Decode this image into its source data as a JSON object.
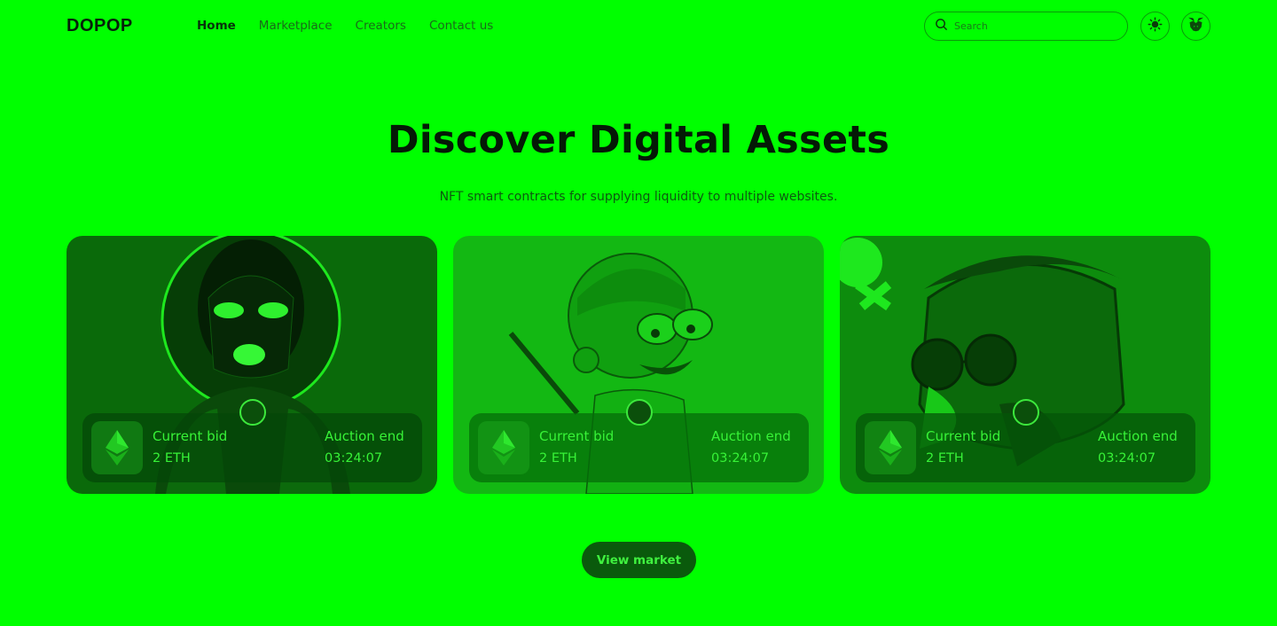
{
  "header": {
    "logo": "DOPOP",
    "nav": [
      {
        "label": "Home",
        "active": true
      },
      {
        "label": "Marketplace",
        "active": false
      },
      {
        "label": "Creators",
        "active": false
      },
      {
        "label": "Contact us",
        "active": false
      }
    ],
    "search_placeholder": "Search",
    "icons": {
      "search": "search-icon",
      "theme": "sun-icon",
      "wallet": "metamask-fox-icon"
    }
  },
  "hero": {
    "title": "Discover Digital Assets",
    "subtitle": "NFT smart contracts for supplying liquidity to multiple websites."
  },
  "cards": [
    {
      "bid_label": "Current bid",
      "bid_value": "2 ETH",
      "end_label": "Auction end",
      "end_value": "03:24:07",
      "currency_icon": "ethereum-icon"
    },
    {
      "bid_label": "Current bid",
      "bid_value": "2 ETH",
      "end_label": "Auction end",
      "end_value": "03:24:07",
      "currency_icon": "ethereum-icon"
    },
    {
      "bid_label": "Current bid",
      "bid_value": "2 ETH",
      "end_label": "Auction end",
      "end_value": "03:24:07",
      "currency_icon": "ethereum-icon"
    }
  ],
  "cta": {
    "label": "View market"
  },
  "colors": {
    "background": "#00ff00",
    "accent_text": "#37f237",
    "dark_text": "#041a06"
  }
}
